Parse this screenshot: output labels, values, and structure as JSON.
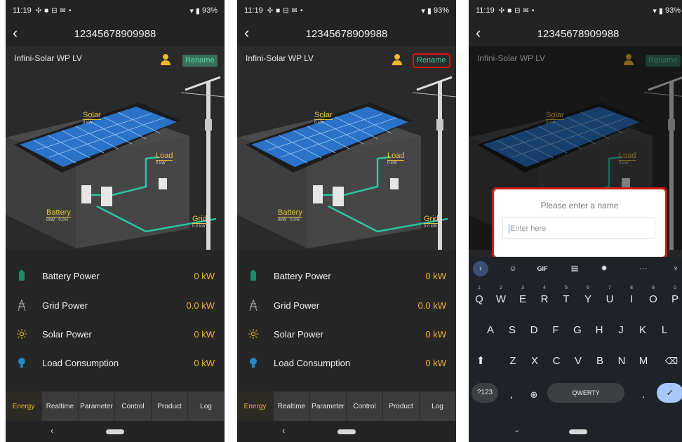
{
  "status": {
    "time": "11:19",
    "battery": "93%"
  },
  "header": {
    "title": "12345678909988"
  },
  "device": {
    "name": "Infini-Solar WP LV",
    "rename_label": "Rename"
  },
  "diagram": {
    "solar": {
      "label": "Solar",
      "value": "0 kW"
    },
    "load": {
      "label": "Load",
      "value": "0 kW"
    },
    "battery": {
      "label": "Battery",
      "value": "0kW · 0.0%"
    },
    "grid": {
      "label": "Grid",
      "value": "0.0 kW"
    }
  },
  "metrics": [
    {
      "label": "Battery Power",
      "value": "0 kW",
      "icon": "battery-icon"
    },
    {
      "label": "Grid Power",
      "value": "0.0 kW",
      "icon": "power-tower-icon"
    },
    {
      "label": "Solar Power",
      "value": "0 kW",
      "icon": "sun-icon"
    },
    {
      "label": "Load Consumption",
      "value": "0 kW",
      "icon": "bulb-icon"
    }
  ],
  "tabs": [
    "Energy",
    "Realtime",
    "Parameter",
    "Control",
    "Product",
    "Log"
  ],
  "dialog": {
    "title": "Please enter a name",
    "placeholder": "Enter here"
  },
  "keyboard": {
    "tools": {
      "gif": "GIF",
      "more": "···"
    },
    "row1": [
      "Q",
      "W",
      "E",
      "R",
      "T",
      "Y",
      "U",
      "I",
      "O",
      "P"
    ],
    "row1_hints": [
      "1",
      "2",
      "3",
      "4",
      "5",
      "6",
      "7",
      "8",
      "9",
      "0"
    ],
    "row2": [
      "A",
      "S",
      "D",
      "F",
      "G",
      "H",
      "J",
      "K",
      "L"
    ],
    "row3": [
      "Z",
      "X",
      "C",
      "V",
      "B",
      "N",
      "M"
    ],
    "symbols_label": "?123",
    "comma": ",",
    "space_label": "QWERTY",
    "period": "."
  },
  "colors": {
    "accent_orange": "#f2b134",
    "label_yellow": "#e8c53c",
    "rename_green": "#58d6a8",
    "highlight_red": "#d21818"
  }
}
